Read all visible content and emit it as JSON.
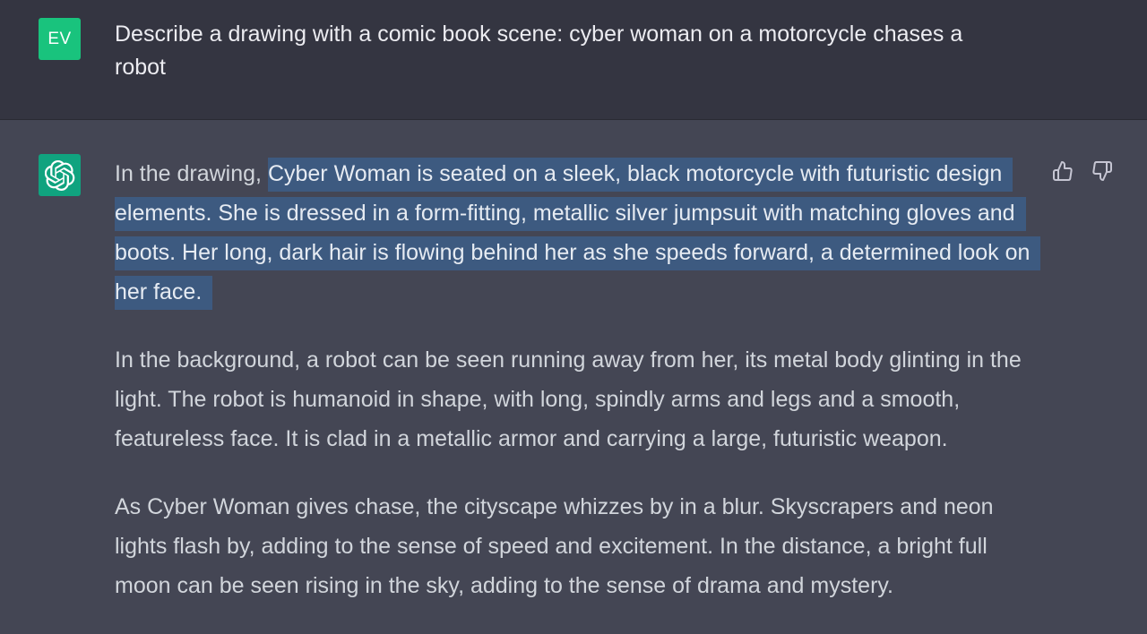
{
  "user": {
    "avatar_initials": "EV",
    "message": "Describe a drawing with a comic book scene: cyber woman on a motorcycle chases a robot"
  },
  "assistant": {
    "avatar_icon": "openai-logo-icon",
    "paragraphs": [
      {
        "before_highlight": "In the drawing, ",
        "highlighted": "Cyber Woman is seated on a sleek, black motorcycle with futuristic design elements. She is dressed in a form-fitting, metallic silver jumpsuit with matching gloves and boots. Her long, dark hair is flowing behind her as she speeds forward, a determined look on her face."
      },
      {
        "text": "In the background, a robot can be seen running away from her, its metal body glinting in the light. The robot is humanoid in shape, with long, spindly arms and legs and a smooth, featureless face. It is clad in a metallic armor and carrying a large, futuristic weapon."
      },
      {
        "text": "As Cyber Woman gives chase, the cityscape whizzes by in a blur. Skyscrapers and neon lights flash by, adding to the sense of speed and excitement. In the distance, a bright full moon can be seen rising in the sky, adding to the sense of drama and mystery."
      }
    ],
    "feedback_icons": [
      "thumbs-up-icon",
      "thumbs-down-icon"
    ]
  },
  "colors": {
    "user_bg": "#343541",
    "assistant_bg": "#444654",
    "user_avatar": "#19c37d",
    "bot_avatar": "#10a37f",
    "selection": "#3d5a80",
    "text": "#d1d5db"
  }
}
